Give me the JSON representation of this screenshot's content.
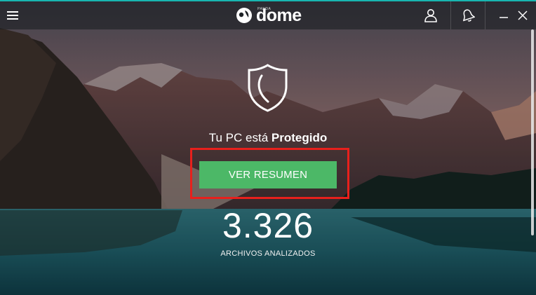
{
  "app": {
    "brand_small": "PANDA",
    "brand_name": "dome",
    "accent_color": "#18b6b0"
  },
  "header": {
    "menu_icon": "hamburger-menu-icon",
    "user_icon": "user-icon",
    "notifications_icon": "bell-icon",
    "minimize_icon": "minimize-icon",
    "close_icon": "close-icon"
  },
  "status": {
    "prefix": "Tu PC está",
    "state": "Protegido",
    "icon": "shield-icon"
  },
  "summary_button": {
    "label": "VER RESUMEN",
    "color": "#4cb867",
    "highlight_color": "#e8201c"
  },
  "scan": {
    "count": "3.326",
    "label": "ARCHIVOS ANALIZADOS"
  }
}
